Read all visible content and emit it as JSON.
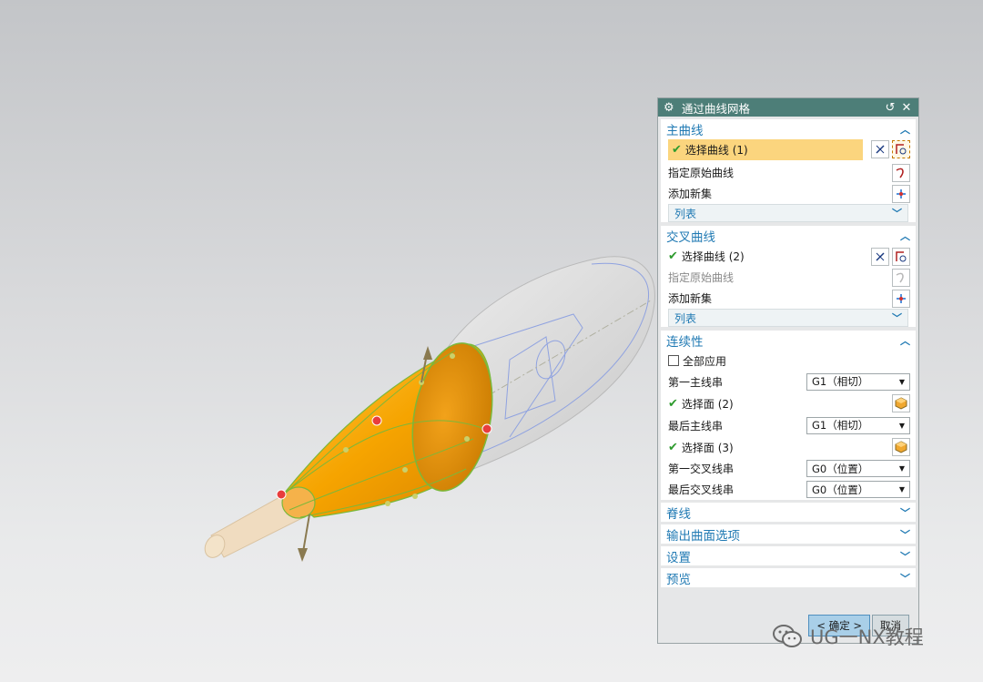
{
  "dialog": {
    "title": "通过曲线网格",
    "sections": {
      "primary": {
        "title": "主曲线",
        "select_curve": "选择曲线 (1)",
        "specify_origin": "指定原始曲线",
        "add_new_set": "添加新集",
        "list": "列表"
      },
      "cross": {
        "title": "交叉曲线",
        "select_curve": "选择曲线 (2)",
        "specify_origin": "指定原始曲线",
        "add_new_set": "添加新集",
        "list": "列表"
      },
      "continuity": {
        "title": "连续性",
        "apply_all": "全部应用",
        "first_primary": "第一主线串",
        "first_primary_value": "G1（相切）",
        "select_face_1": "选择面 (2)",
        "last_primary": "最后主线串",
        "last_primary_value": "G1（相切）",
        "select_face_2": "选择面 (3)",
        "first_cross": "第一交叉线串",
        "first_cross_value": "G0（位置）",
        "last_cross": "最后交叉线串",
        "last_cross_value": "G0（位置）"
      },
      "spine": {
        "title": "脊线"
      },
      "output": {
        "title": "输出曲面选项"
      },
      "settings": {
        "title": "设置"
      },
      "preview": {
        "title": "预览"
      }
    },
    "buttons": {
      "ok": "< 确定 >",
      "cancel": "取消"
    }
  },
  "watermark": {
    "text": "UG一NX教程"
  },
  "colors": {
    "titlebar": "#4d7e78",
    "section_heading": "#1f79b3",
    "selected_row": "#fbd57e",
    "surface": "#f5a300"
  }
}
